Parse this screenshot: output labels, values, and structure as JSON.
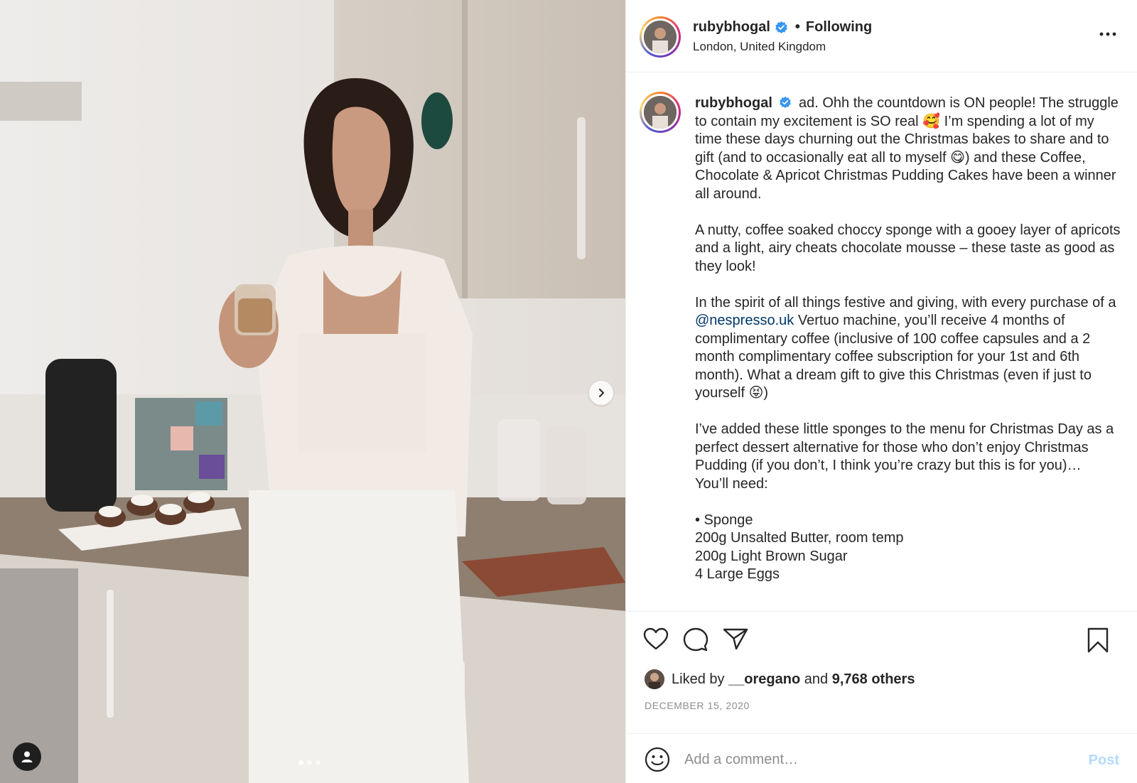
{
  "post": {
    "username": "rubybhogal",
    "verified": true,
    "follow_status": "Following",
    "separator": "•",
    "location": "London, United Kingdom"
  },
  "caption": {
    "username": "rubybhogal",
    "paragraphs": [
      "ad. Ohh the countdown is ON people! The struggle to contain my excitement is SO real 🥰 I’m spending a lot of my time these days churning out the Christmas bakes to share and to gift (and to occasionally eat all to myself 😋) and these Coffee, Chocolate & Apricot Christmas Pudding Cakes have been a winner all around.",
      "A nutty, coffee soaked choccy sponge with a gooey layer of apricots and a light, airy cheats chocolate mousse – these taste as good as they look!",
      "In the spirit of all things festive and giving, with every purchase of a",
      "@nespresso.uk",
      "Vertuo machine, you’ll receive 4 months of complimentary coffee (inclusive of 100 coffee capsules and a 2 month complimentary coffee subscription for your 1st and 6th month). What a dream gift to give this Christmas (even if just to yourself 😝)",
      "I’ve added these little sponges to the menu for Christmas Day as a perfect dessert alternative for those who don’t enjoy Christmas Pudding (if you don’t, I think you’re crazy but this is for you)…",
      "You’ll need:",
      "• Sponge",
      "200g Unsalted Butter, room temp",
      "200g Light Brown Sugar",
      "4 Large Eggs"
    ]
  },
  "likes": {
    "prefix": "Liked by",
    "user": "__oregano",
    "conjunction": "and",
    "others": "9,768 others"
  },
  "date": "DECEMBER 15, 2020",
  "comment": {
    "placeholder": "Add a comment…",
    "post_label": "Post"
  },
  "carousel": {
    "slides": 3,
    "active_index": 0
  },
  "icons": {
    "like": "heart-icon",
    "comment": "comment-bubble-icon",
    "share": "paper-plane-icon",
    "save": "bookmark-icon",
    "more": "more-options-icon",
    "emoji": "emoji-smile-icon",
    "next": "chevron-right-icon",
    "tagged": "user-tag-icon"
  },
  "colors": {
    "link": "#00376b",
    "verified": "#3897f0",
    "post_disabled": "#b3dbff",
    "muted": "#8e8e8e"
  }
}
